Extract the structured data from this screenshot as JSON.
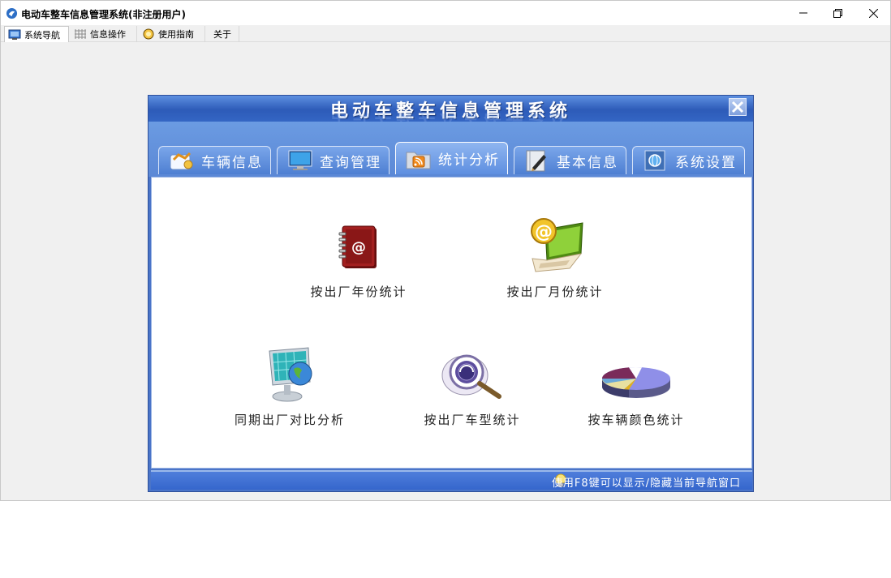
{
  "window": {
    "title": "电动车整车信息管理系统(非注册用户)"
  },
  "menu": {
    "tabs": [
      {
        "label": "系统导航",
        "icon": "monitor-icon"
      },
      {
        "label": "信息操作",
        "icon": "grid-icon"
      },
      {
        "label": "使用指南",
        "icon": "guide-icon"
      },
      {
        "label": "关于",
        "icon": ""
      }
    ]
  },
  "panel": {
    "title": "电动车整车信息管理系统",
    "tabs": [
      {
        "label": "车辆信息",
        "icon": "vehicle-info-icon"
      },
      {
        "label": "查询管理",
        "icon": "query-monitor-icon"
      },
      {
        "label": "统计分析",
        "icon": "rss-folder-icon"
      },
      {
        "label": "基本信息",
        "icon": "notebook-pen-icon"
      },
      {
        "label": "系统设置",
        "icon": "settings-globe-icon"
      }
    ],
    "features": [
      {
        "label": "按出厂年份统计",
        "icon": "address-book-icon"
      },
      {
        "label": "按出厂月份统计",
        "icon": "email-laptop-icon"
      },
      {
        "label": "同期出厂对比分析",
        "icon": "globe-monitor-icon"
      },
      {
        "label": "按出厂车型统计",
        "icon": "magnifier-disc-icon"
      },
      {
        "label": "按车辆颜色统计",
        "icon": "pie-chart-icon"
      }
    ],
    "status": "使用F8键可以显示/隐藏当前导航窗口"
  },
  "colors": {
    "panel_blue": "#4a74c8",
    "header_blue": "#2d5bb8",
    "tab_blue": "#5e8fe0"
  }
}
